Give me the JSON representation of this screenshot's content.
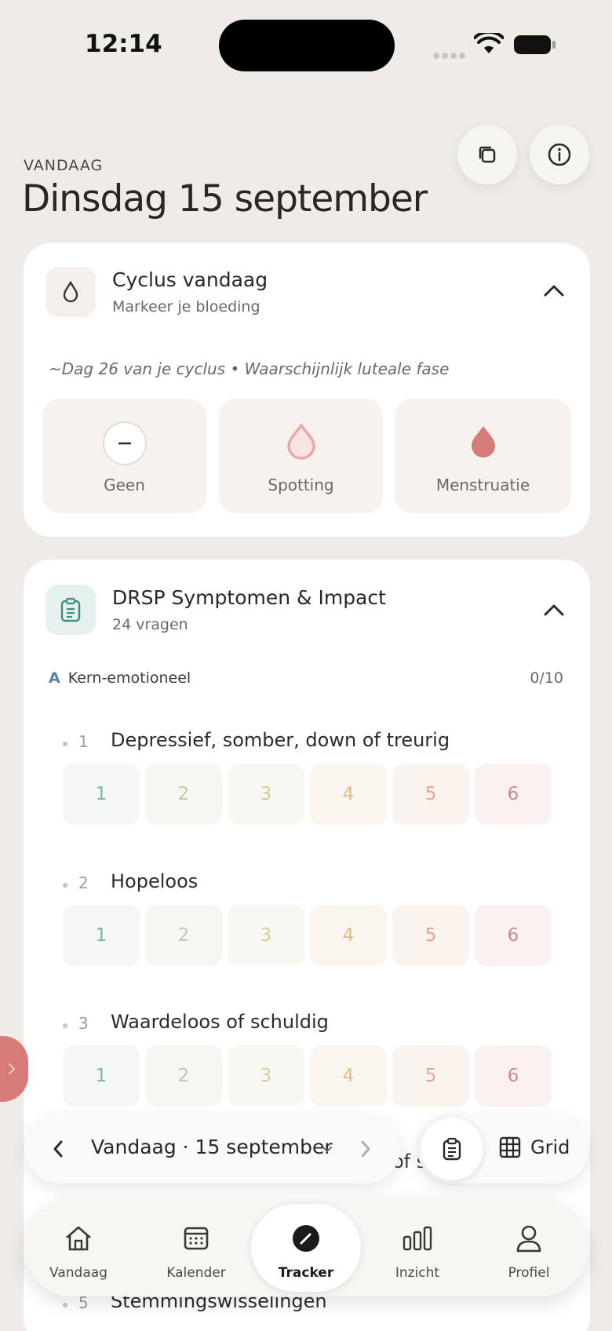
{
  "status": {
    "time": "12:14"
  },
  "header": {
    "eyebrow": "VANDAAG",
    "title": "Dinsdag 15 september"
  },
  "cycle_card": {
    "title": "Cyclus vandaag",
    "subtitle": "Markeer je bloeding",
    "hint": "~Dag 26 van je cyclus • Waarschijnlijk luteale fase",
    "options": [
      {
        "label": "Geen",
        "icon": "minus-circle-icon"
      },
      {
        "label": "Spotting",
        "icon": "drop-outline-icon"
      },
      {
        "label": "Menstruatie",
        "icon": "drop-filled-icon"
      }
    ]
  },
  "drsp_card": {
    "title": "DRSP Symptomen & Impact",
    "subtitle": "24 vragen",
    "section": {
      "letter": "A",
      "label": "Kern-emotioneel",
      "count": "0/10"
    },
    "scale": [
      "1",
      "2",
      "3",
      "4",
      "5",
      "6"
    ],
    "questions": [
      {
        "num": "1",
        "text": "Depressief, somber, down of treurig"
      },
      {
        "num": "2",
        "text": "Hopeloos"
      },
      {
        "num": "3",
        "text": "Waardeloos of schuldig"
      }
    ],
    "peek_partial": "of s",
    "peek_next": {
      "num": "5",
      "text": "Stemmingswisselingen"
    }
  },
  "date_nav": {
    "label": "Vandaag · 15 september"
  },
  "view_switch": {
    "grid_label": "Grid"
  },
  "tabs": [
    {
      "label": "Vandaag",
      "icon": "home-icon"
    },
    {
      "label": "Kalender",
      "icon": "calendar-icon"
    },
    {
      "label": "Tracker",
      "icon": "tracker-icon"
    },
    {
      "label": "Inzicht",
      "icon": "bar-chart-icon"
    },
    {
      "label": "Profiel",
      "icon": "user-icon"
    }
  ],
  "colors": {
    "background": "#efebe6",
    "accent_teal": "#5e9e96",
    "menstruation": "#d67b78"
  }
}
